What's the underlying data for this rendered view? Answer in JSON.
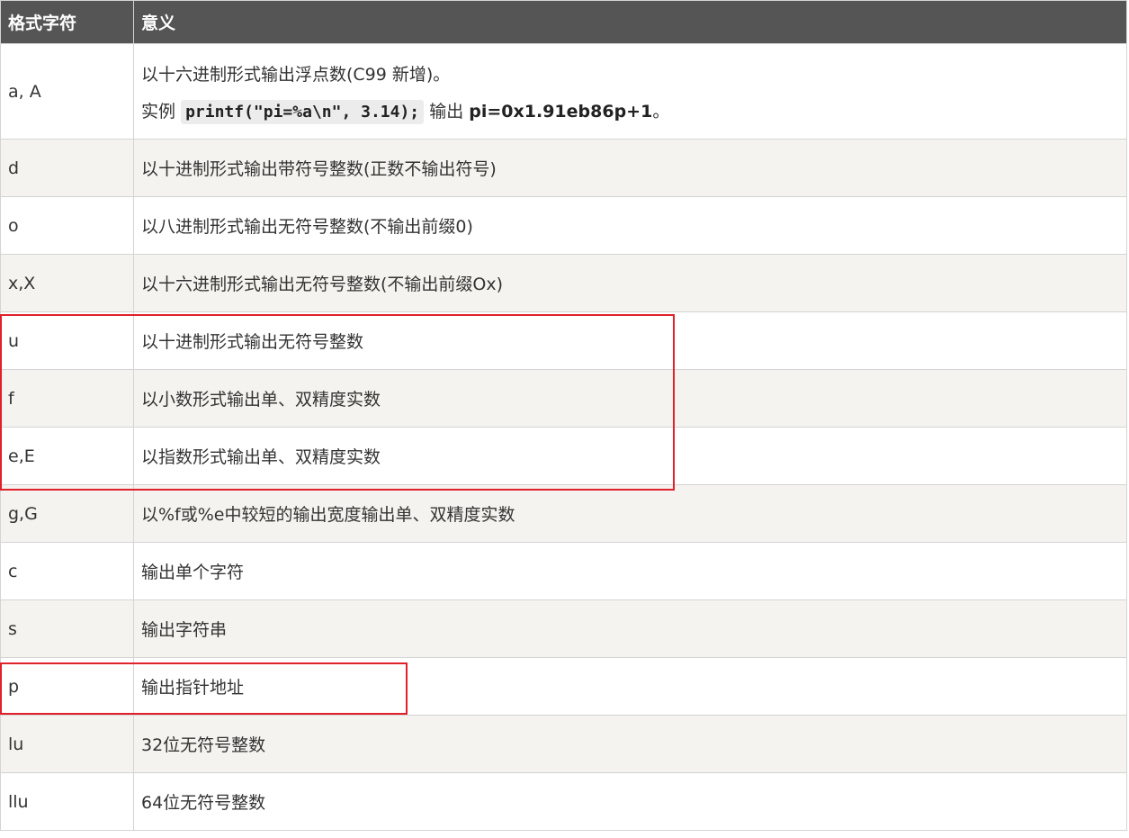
{
  "table": {
    "headers": [
      "格式字符",
      "意义"
    ],
    "row_a": {
      "format": "a, A",
      "line1": "以十六进制形式输出浮点数(C99 新增)。",
      "example_prefix": "实例",
      "example_code": "printf(\"pi=%a\\n\", 3.14);",
      "example_mid": "输出",
      "example_result": "pi=0x1.91eb86p+1",
      "example_end": "。"
    },
    "rows": [
      {
        "format": "d",
        "meaning": "以十进制形式输出带符号整数(正数不输出符号)"
      },
      {
        "format": "o",
        "meaning": "以八进制形式输出无符号整数(不输出前缀0)"
      },
      {
        "format": "x,X",
        "meaning": "以十六进制形式输出无符号整数(不输出前缀Ox)"
      },
      {
        "format": "u",
        "meaning": "以十进制形式输出无符号整数"
      },
      {
        "format": "f",
        "meaning": "以小数形式输出单、双精度实数"
      },
      {
        "format": "e,E",
        "meaning": "以指数形式输出单、双精度实数"
      },
      {
        "format": "g,G",
        "meaning": "以%f或%e中较短的输出宽度输出单、双精度实数"
      },
      {
        "format": "c",
        "meaning": "输出单个字符"
      },
      {
        "format": "s",
        "meaning": "输出字符串"
      },
      {
        "format": "p",
        "meaning": "输出指针地址"
      },
      {
        "format": "lu",
        "meaning": "32位无符号整数"
      },
      {
        "format": "llu",
        "meaning": "64位无符号整数"
      }
    ]
  },
  "highlight_color": "#e0202a"
}
